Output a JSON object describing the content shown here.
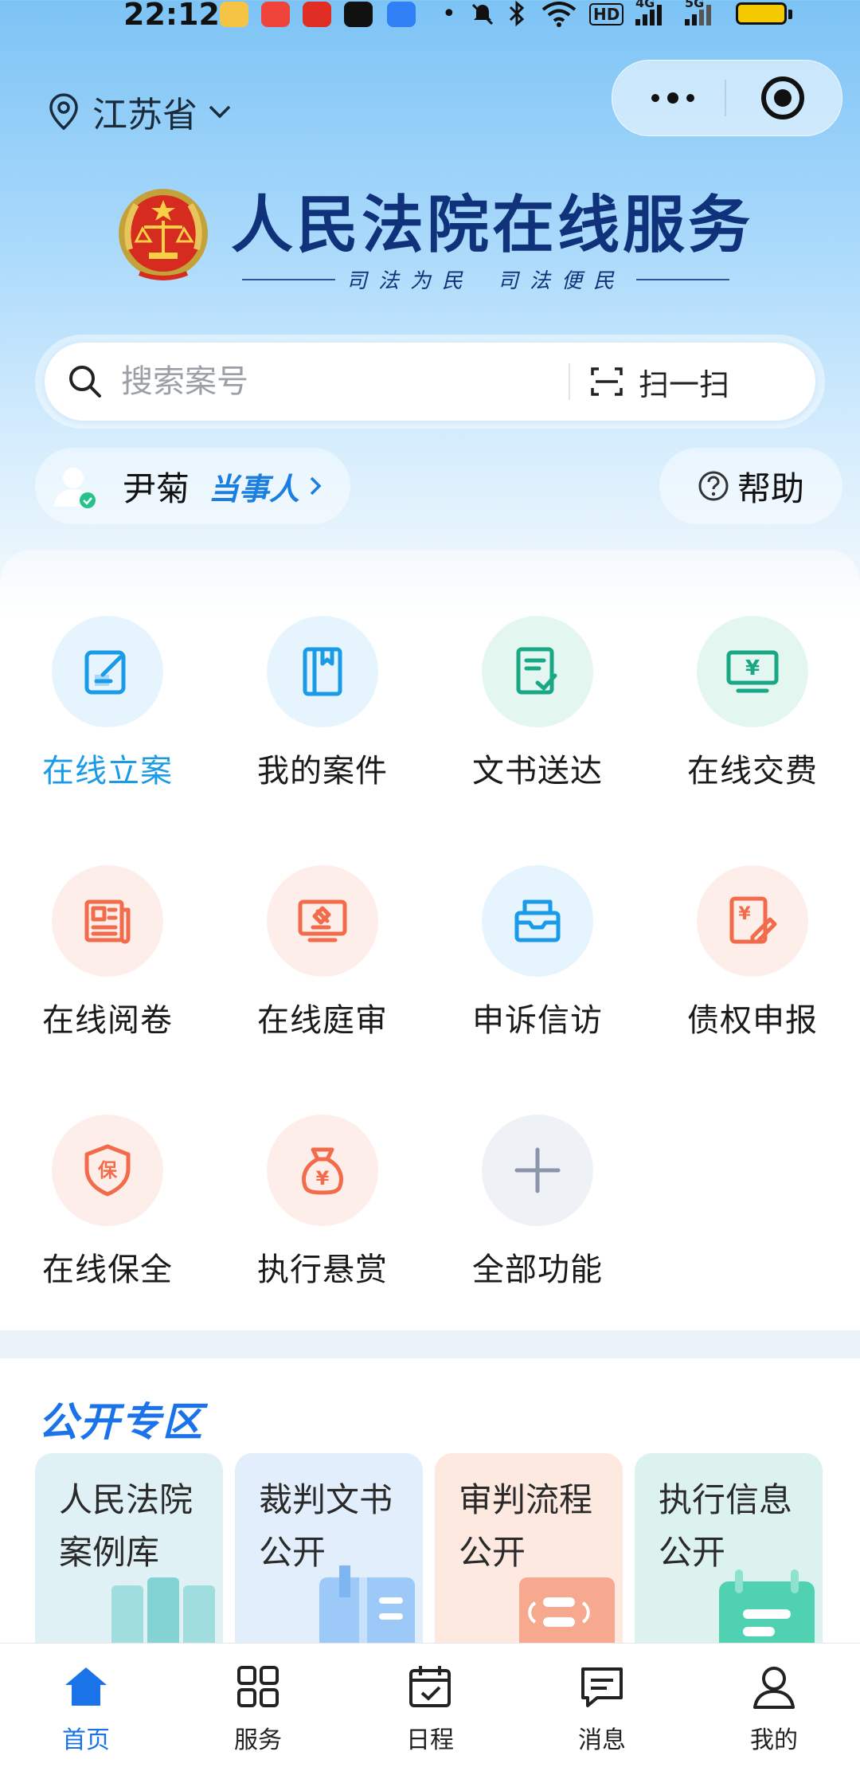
{
  "status_bar": {
    "time": "22:12",
    "network_1": "4G",
    "network_2": "5G",
    "hd_label": "HD"
  },
  "header": {
    "location": "江苏省",
    "app_title": "人民法院在线服务",
    "slogan_left": "司法为民",
    "slogan_right": "司法便民"
  },
  "search": {
    "placeholder": "搜索案号",
    "scan_label": "扫一扫"
  },
  "user": {
    "name": "尹菊",
    "role": "当事人",
    "help_label": "帮助"
  },
  "services": [
    {
      "label": "在线立案",
      "icon": "edit-icon",
      "color": "#1a9be8",
      "bg": "#e6f4fd"
    },
    {
      "label": "我的案件",
      "icon": "book-icon",
      "color": "#1a9be8",
      "bg": "#e6f4fd"
    },
    {
      "label": "文书送达",
      "icon": "document-check-icon",
      "color": "#19a786",
      "bg": "#e4f6f0"
    },
    {
      "label": "在线交费",
      "icon": "payment-monitor-icon",
      "color": "#19a786",
      "bg": "#e4f6f0"
    },
    {
      "label": "在线阅卷",
      "icon": "newspaper-icon",
      "color": "#f26b4a",
      "bg": "#fdeee9"
    },
    {
      "label": "在线庭审",
      "icon": "gavel-monitor-icon",
      "color": "#f26b4a",
      "bg": "#fdeee9"
    },
    {
      "label": "申诉信访",
      "icon": "mailbox-icon",
      "color": "#1a9be8",
      "bg": "#e6f4fd"
    },
    {
      "label": "债权申报",
      "icon": "claim-document-icon",
      "color": "#f26b4a",
      "bg": "#fdeee9"
    },
    {
      "label": "在线保全",
      "icon": "shield-icon",
      "color": "#f26b4a",
      "bg": "#fdeee9"
    },
    {
      "label": "执行悬赏",
      "icon": "money-bag-icon",
      "color": "#f26b4a",
      "bg": "#fdeee9"
    },
    {
      "label": "全部功能",
      "icon": "plus-icon",
      "color": "#8c96a8",
      "bg": "#eef1f6"
    }
  ],
  "active_service_color": "#1a9be8",
  "public_zone": {
    "title": "公开专区",
    "cards": [
      {
        "label": "人民法院案例库",
        "bg": "#dff1f5"
      },
      {
        "label": "裁判文书公开",
        "bg": "#e3eefc"
      },
      {
        "label": "审判流程公开",
        "bg": "#fde9e0"
      },
      {
        "label": "执行信息公开",
        "bg": "#dcf2ef"
      }
    ]
  },
  "tabs": [
    {
      "label": "首页",
      "icon": "home-icon"
    },
    {
      "label": "服务",
      "icon": "grid-icon"
    },
    {
      "label": "日程",
      "icon": "calendar-icon"
    },
    {
      "label": "消息",
      "icon": "message-icon"
    },
    {
      "label": "我的",
      "icon": "user-icon"
    }
  ],
  "colors": {
    "accent": "#1a73e8",
    "title": "#10327a"
  }
}
